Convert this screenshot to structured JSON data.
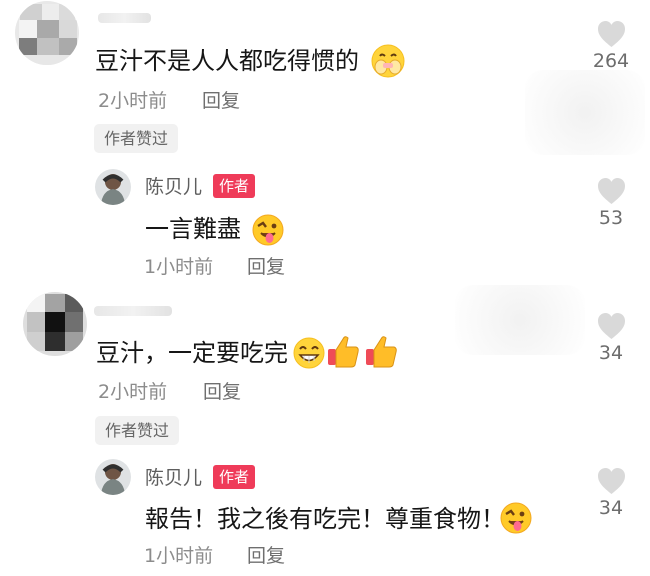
{
  "comments": [
    {
      "text": "豆汁不是人人都吃得惯的",
      "time": "2小时前",
      "reply": "回复",
      "liked_tag": "作者赞过",
      "likes": "264",
      "emoji": "hands-over-mouth-emoji",
      "avatar": "blurred-user-avatar",
      "reply_thread": {
        "author": "陈贝儿",
        "badge": "作者",
        "text": "一言難盡",
        "time": "1小时前",
        "reply": "回复",
        "likes": "53",
        "emoji": "winking-tongue-emoji"
      }
    },
    {
      "text": "豆汁，一定要吃完",
      "time": "2小时前",
      "reply": "回复",
      "liked_tag": "作者赞过",
      "likes": "34",
      "emoji": "grin-emoji",
      "avatar": "blurred-user-avatar",
      "reply_thread": {
        "author": "陈贝儿",
        "badge": "作者",
        "text": "報告！我之後有吃完！尊重食物！",
        "time": "1小时前",
        "reply": "回复",
        "likes": "34",
        "emoji": "winking-tongue-emoji"
      }
    }
  ],
  "colors": {
    "author_badge": "#ef3b59",
    "like_icon": "#d9d9d9",
    "text": "#161616",
    "muted_text": "#8c8c8c"
  }
}
